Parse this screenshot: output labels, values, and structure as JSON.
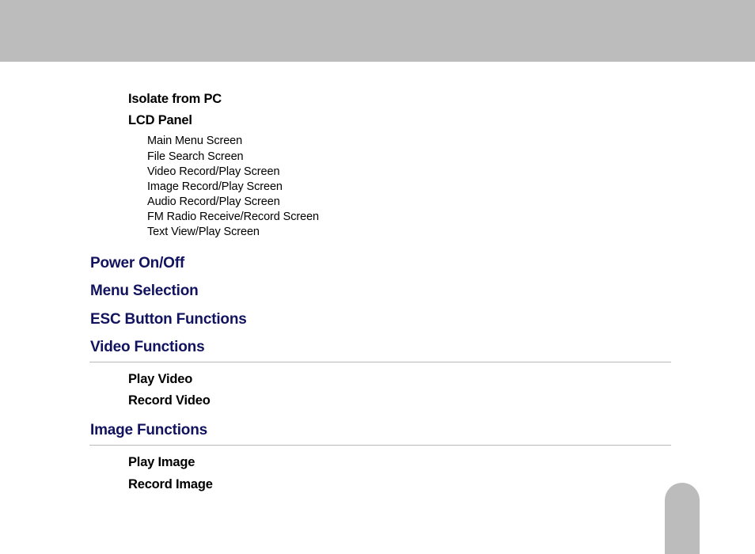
{
  "toc": {
    "sub_items_top": [
      {
        "label": "Isolate from PC"
      },
      {
        "label": "LCD Panel"
      }
    ],
    "leaf_items": [
      "Main Menu Screen",
      "File Search Screen",
      "Video Record/Play Screen",
      "Image Record/Play Screen",
      "Audio Record/Play Screen",
      "FM Radio Receive/Record Screen",
      "Text View/Play Screen"
    ],
    "sections": [
      {
        "title": "Power On/Off",
        "divider": false,
        "children": []
      },
      {
        "title": "Menu Selection",
        "divider": false,
        "children": []
      },
      {
        "title": "ESC Button Functions",
        "divider": false,
        "children": []
      },
      {
        "title": "Video Functions",
        "divider": true,
        "children": [
          "Play Video",
          "Record Video"
        ]
      },
      {
        "title": "Image Functions",
        "divider": true,
        "children": [
          "Play Image",
          "Record Image"
        ]
      }
    ]
  },
  "colors": {
    "gray_bar": "#bcbcbc",
    "section_blue": "#12135e"
  }
}
